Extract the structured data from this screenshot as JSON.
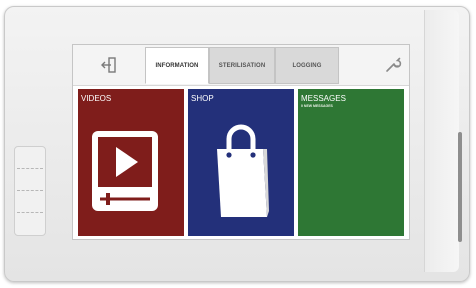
{
  "tabs": [
    {
      "label": "INFORMATION",
      "active": true
    },
    {
      "label": "STERILISATION",
      "active": false
    },
    {
      "label": "LOGGING",
      "active": false
    }
  ],
  "tiles": {
    "videos": {
      "label": "VIDEOS",
      "icon": "video-player-icon",
      "color": "#7f1d1b"
    },
    "shop": {
      "label": "SHOP",
      "icon": "shopping-bag-icon",
      "color": "#23307a"
    },
    "messages": {
      "label": "MESSAGES",
      "sublabel": "0 NEW MESSAGES",
      "color": "#2e7734"
    }
  },
  "header": {
    "left_icon": "exit-door-icon",
    "right_icon": "wrench-icon"
  }
}
